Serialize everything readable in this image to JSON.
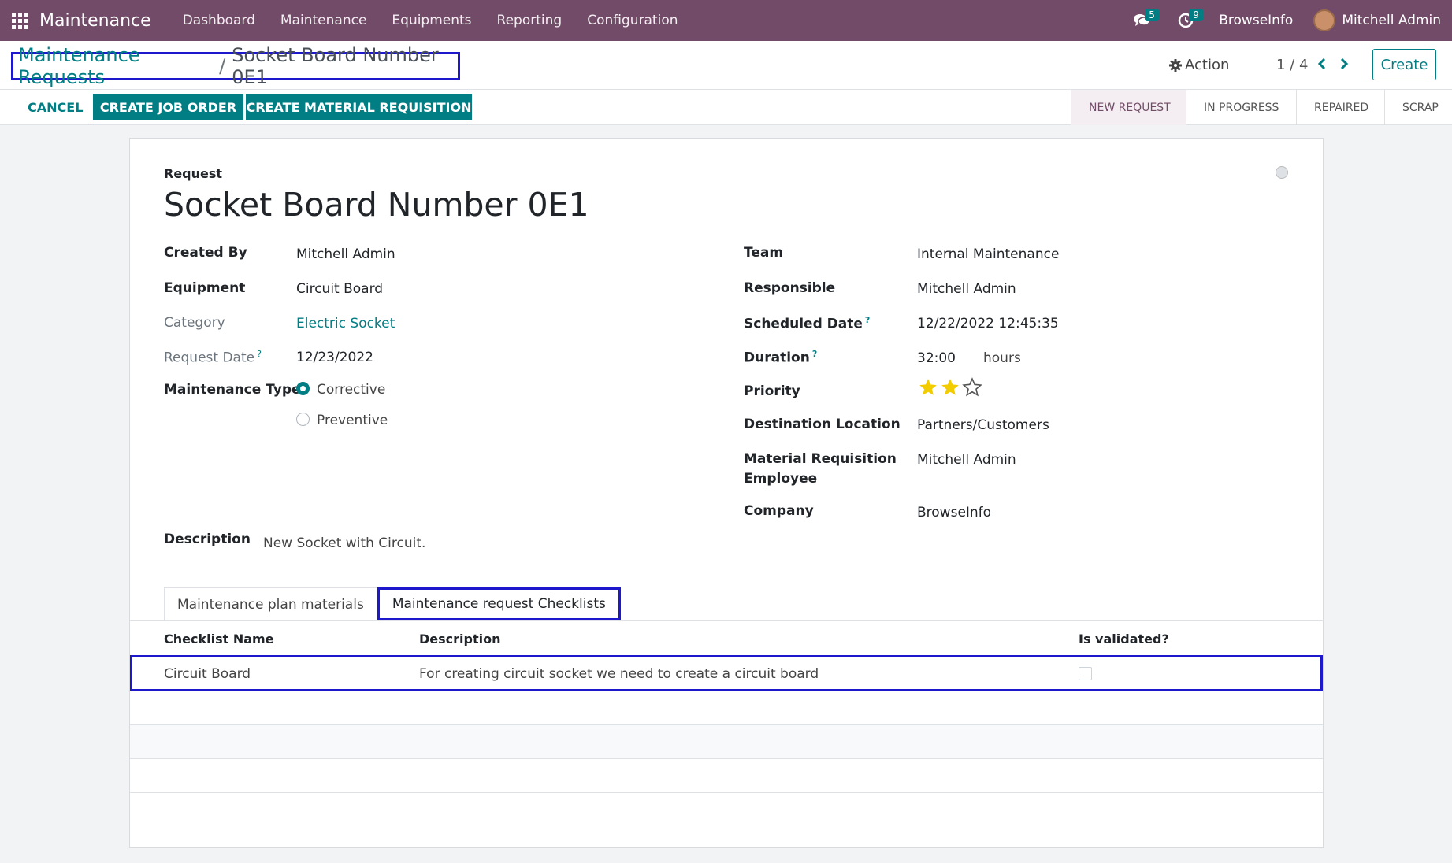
{
  "navbar": {
    "app_name": "Maintenance",
    "menu": [
      "Dashboard",
      "Maintenance",
      "Equipments",
      "Reporting",
      "Configuration"
    ],
    "messages_count": "5",
    "activities_count": "9",
    "company": "BrowseInfo",
    "user": "Mitchell Admin"
  },
  "control_panel": {
    "breadcrumb_parent": "Maintenance Requests",
    "breadcrumb_separator": "/",
    "breadcrumb_current": "Socket Board Number 0E1",
    "action_label": "Action",
    "pager": "1 / 4",
    "create_label": "Create"
  },
  "statusbar": {
    "cancel_label": "CANCEL",
    "job_order_label": "CREATE JOB ORDER",
    "material_req_label": "CREATE MATERIAL REQUISITION",
    "stages": [
      "NEW REQUEST",
      "IN PROGRESS",
      "REPAIRED",
      "SCRAP"
    ],
    "active_stage": "NEW REQUEST"
  },
  "form": {
    "request_label": "Request",
    "title": "Socket Board Number 0E1",
    "left": {
      "created_by_label": "Created By",
      "created_by": "Mitchell Admin",
      "equipment_label": "Equipment",
      "equipment": "Circuit Board",
      "category_label": "Category",
      "category": "Electric Socket",
      "request_date_label": "Request Date",
      "request_date": "12/23/2022",
      "maintenance_type_label": "Maintenance Type",
      "type_corrective": "Corrective",
      "type_preventive": "Preventive",
      "selected_type": "Corrective"
    },
    "right": {
      "team_label": "Team",
      "team": "Internal Maintenance",
      "responsible_label": "Responsible",
      "responsible": "Mitchell Admin",
      "scheduled_date_label": "Scheduled Date",
      "scheduled_date": "12/22/2022 12:45:35",
      "duration_label": "Duration",
      "duration": "32:00",
      "duration_unit": "hours",
      "priority_label": "Priority",
      "priority_stars": 2,
      "priority_max": 3,
      "destination_label": "Destination Location",
      "destination": "Partners/Customers",
      "mr_employee_label_1": "Material Requisition",
      "mr_employee_label_2": "Employee",
      "mr_employee": "Mitchell Admin",
      "company_label": "Company",
      "company": "BrowseInfo"
    },
    "help_mark": "?",
    "description_label": "Description",
    "description": "New Socket with Circuit."
  },
  "tabs": {
    "tab1": "Maintenance plan materials",
    "tab2": "Maintenance request Checklists",
    "active": "Maintenance request Checklists"
  },
  "checklist": {
    "headers": [
      "Checklist Name",
      "Description",
      "Is validated?"
    ],
    "rows": [
      {
        "name": "Circuit Board",
        "description": "For creating circuit socket we need to create a circuit board",
        "validated": false
      }
    ]
  },
  "colors": {
    "brand": "#714b67",
    "accent": "#017e84",
    "highlight": "#1d18cc",
    "star": "#f3cc00"
  }
}
